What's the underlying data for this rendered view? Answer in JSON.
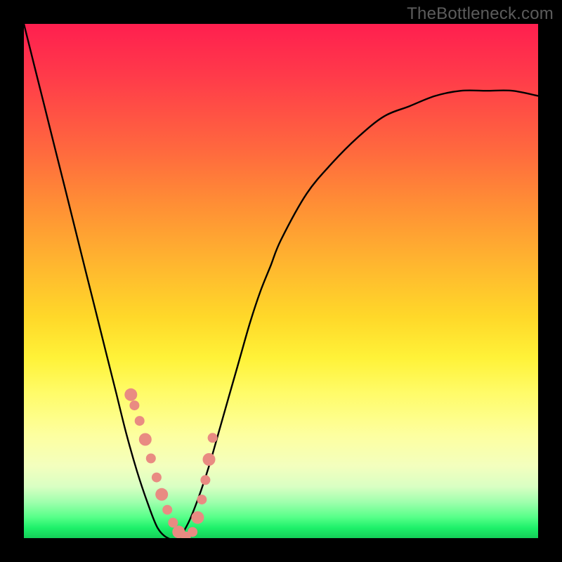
{
  "watermark": {
    "text": "TheBottleneck.com"
  },
  "chart_data": {
    "type": "line",
    "title": "",
    "xlabel": "",
    "ylabel": "",
    "x": [
      0.0,
      0.02,
      0.04,
      0.06,
      0.08,
      0.1,
      0.12,
      0.14,
      0.16,
      0.18,
      0.2,
      0.22,
      0.24,
      0.26,
      0.28,
      0.3,
      0.32,
      0.34,
      0.36,
      0.38,
      0.4,
      0.42,
      0.44,
      0.46,
      0.48,
      0.5,
      0.55,
      0.6,
      0.65,
      0.7,
      0.75,
      0.8,
      0.85,
      0.9,
      0.95,
      1.0
    ],
    "series": [
      {
        "name": "bottleneck-curve",
        "values": [
          1.0,
          0.92,
          0.84,
          0.76,
          0.68,
          0.6,
          0.52,
          0.44,
          0.36,
          0.28,
          0.2,
          0.13,
          0.07,
          0.02,
          0.0,
          0.0,
          0.03,
          0.08,
          0.14,
          0.21,
          0.28,
          0.35,
          0.42,
          0.48,
          0.53,
          0.58,
          0.67,
          0.73,
          0.78,
          0.82,
          0.84,
          0.86,
          0.87,
          0.87,
          0.87,
          0.86
        ]
      }
    ],
    "xlim": [
      0,
      1
    ],
    "ylim": [
      0,
      1
    ],
    "highlight_points": {
      "comment": "pink marker dots/segments overlaid on the curve near its minimum",
      "x": [
        0.208,
        0.215,
        0.225,
        0.236,
        0.247,
        0.258,
        0.268,
        0.279,
        0.29,
        0.301,
        0.315,
        0.328,
        0.338,
        0.346,
        0.353,
        0.36,
        0.367
      ],
      "y": [
        0.279,
        0.258,
        0.228,
        0.192,
        0.155,
        0.118,
        0.085,
        0.055,
        0.03,
        0.012,
        0.003,
        0.012,
        0.04,
        0.075,
        0.113,
        0.153,
        0.195
      ]
    },
    "background_gradient": {
      "direction": "vertical",
      "stops": [
        {
          "pos": 0.0,
          "color": "#ff1f4f"
        },
        {
          "pos": 0.25,
          "color": "#ff6a3e"
        },
        {
          "pos": 0.5,
          "color": "#ffc82c"
        },
        {
          "pos": 0.72,
          "color": "#fffc6a"
        },
        {
          "pos": 0.9,
          "color": "#d9ffc3"
        },
        {
          "pos": 1.0,
          "color": "#14cf58"
        }
      ]
    }
  }
}
